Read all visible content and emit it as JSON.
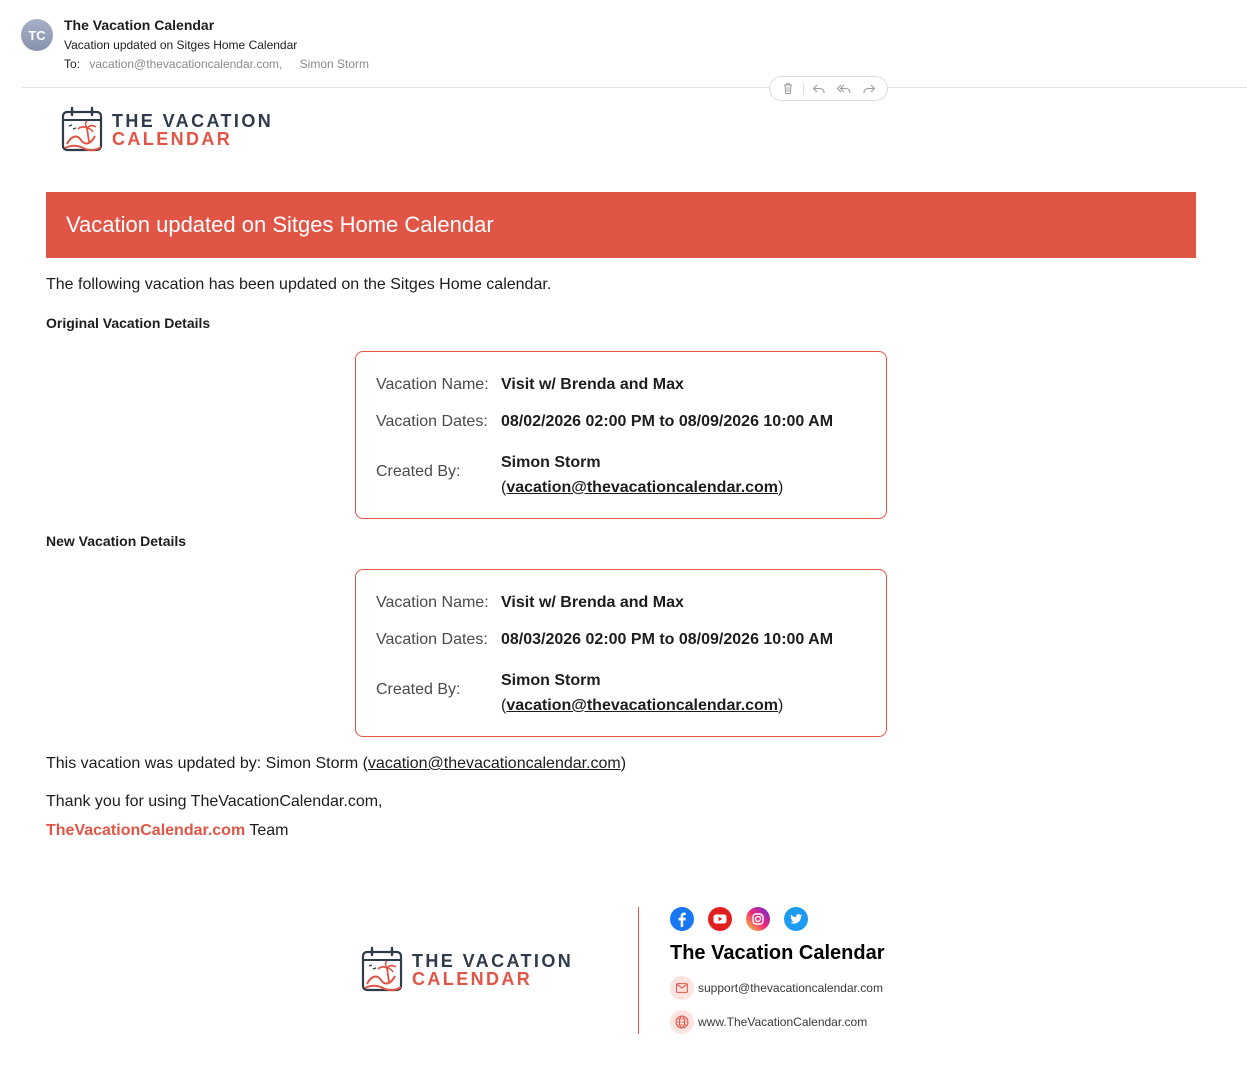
{
  "mail": {
    "avatar_initials": "TC",
    "sender": "The Vacation Calendar",
    "subject": "Vacation updated on Sitges Home Calendar",
    "to_label": "To:",
    "to_address": "vacation@thevacationcalendar.com,",
    "to_recipient": "Simon Storm",
    "toolbar_icons": [
      "trash-icon",
      "reply-icon",
      "reply-all-icon",
      "forward-icon"
    ]
  },
  "logo": {
    "line1": "THE VACATION",
    "line2": "CALENDAR"
  },
  "colors": {
    "brand": "#e05546",
    "dark": "#2f3a4a"
  },
  "banner": {
    "title": "Vacation updated on Sitges Home Calendar"
  },
  "intro": "The following vacation has been updated on the Sitges Home calendar.",
  "original": {
    "heading": "Original Vacation Details",
    "name_label": "Vacation Name:",
    "name_value": "Visit w/ Brenda and Max",
    "dates_label": "Vacation Dates:",
    "dates_value": "08/02/2026 02:00 PM to 08/09/2026 10:00 AM",
    "created_label": "Created By:",
    "created_name": "Simon Storm",
    "created_email": "vacation@thevacationcalendar.com"
  },
  "new": {
    "heading": "New Vacation Details",
    "name_label": "Vacation Name:",
    "name_value": "Visit w/ Brenda and Max",
    "dates_label": "Vacation Dates:",
    "dates_value": "08/03/2026 02:00 PM to 08/09/2026 10:00 AM",
    "created_label": "Created By:",
    "created_name": "Simon Storm",
    "created_email": "vacation@thevacationcalendar.com"
  },
  "updated_by": {
    "prefix": "This vacation was updated by: Simon Storm (",
    "email": "vacation@thevacationcalendar.com",
    "suffix": ")"
  },
  "thanks": "Thank you for using TheVacationCalendar.com,",
  "team": {
    "brand": "TheVacationCalendar.com",
    "suffix": " Team"
  },
  "footer": {
    "name": "The Vacation Calendar",
    "socials": [
      "facebook-icon",
      "youtube-icon",
      "instagram-icon",
      "twitter-icon"
    ],
    "email": "support@thevacationcalendar.com",
    "website": "www.TheVacationCalendar.com"
  }
}
